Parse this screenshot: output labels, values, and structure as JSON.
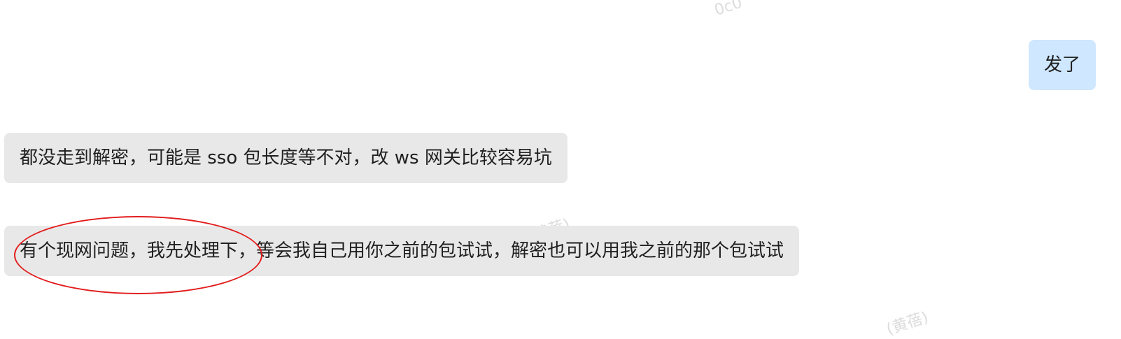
{
  "watermarks": [
    {
      "text": "0c0"
    },
    {
      "text": "(黄蓓)"
    },
    {
      "text": "(黄蓓)"
    }
  ],
  "messages": [
    {
      "side": "outgoing",
      "text": "发了"
    },
    {
      "side": "incoming",
      "text": "都没走到解密，可能是 sso 包长度等不对，改 ws 网关比较容易坑"
    },
    {
      "side": "incoming",
      "text": "有个现网问题，我先处理下，等会我自己用你之前的包试试，解密也可以用我之前的那个包试试"
    }
  ],
  "colors": {
    "incoming_bubble": "#e8e8e8",
    "outgoing_bubble": "#cfe7ff",
    "annotation": "#e21b1b"
  }
}
